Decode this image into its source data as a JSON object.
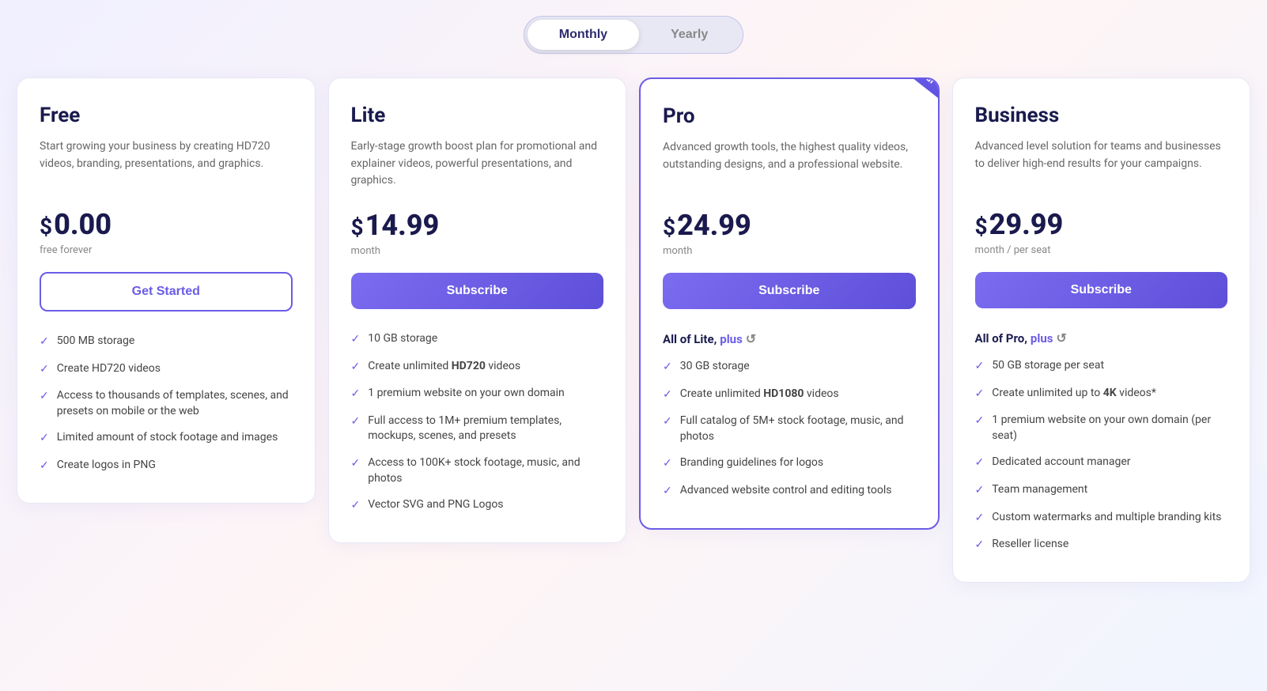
{
  "toggle": {
    "monthly_label": "Monthly",
    "yearly_label": "Yearly",
    "active": "monthly"
  },
  "plans": [
    {
      "id": "free",
      "name": "Free",
      "desc": "Start growing your business by creating HD720 videos, branding, presentations, and graphics.",
      "price_symbol": "$",
      "price_amount": "0.00",
      "price_period": "free forever",
      "button_label": "Get Started",
      "button_type": "outline",
      "features_header": null,
      "features": [
        {
          "text": "500 MB storage",
          "bold": null
        },
        {
          "text": "Create HD720 videos",
          "bold": null
        },
        {
          "text": "Access to thousands of templates, scenes, and presets on mobile or the web",
          "bold": null
        },
        {
          "text": "Limited amount of stock footage and images",
          "bold": null
        },
        {
          "text": "Create logos in PNG",
          "bold": null
        }
      ]
    },
    {
      "id": "lite",
      "name": "Lite",
      "desc": "Early-stage growth boost plan for promotional and explainer videos, powerful presentations, and graphics.",
      "price_symbol": "$",
      "price_amount": "14.99",
      "price_period": "month",
      "button_label": "Subscribe",
      "button_type": "filled",
      "features_header": null,
      "features": [
        {
          "text": "10 GB storage",
          "bold": null
        },
        {
          "text": "Create unlimited HD720 videos",
          "bold": "HD720"
        },
        {
          "text": "1 premium website on your own domain",
          "bold": null
        },
        {
          "text": "Full access to 1M+ premium templates, mockups, scenes, and presets",
          "bold": null
        },
        {
          "text": "Access to 100K+ stock footage, music, and photos",
          "bold": null
        },
        {
          "text": "Vector SVG and PNG Logos",
          "bold": null
        }
      ]
    },
    {
      "id": "pro",
      "name": "Pro",
      "desc": "Advanced growth tools, the highest quality videos, outstanding designs, and a professional website.",
      "price_symbol": "$",
      "price_amount": "24.99",
      "price_period": "month",
      "button_label": "Subscribe",
      "button_type": "filled",
      "ribbon": "Most Popular",
      "features_header": "All of Lite, plus",
      "features": [
        {
          "text": "30 GB storage",
          "bold": null
        },
        {
          "text": "Create unlimited HD1080 videos",
          "bold": "HD1080"
        },
        {
          "text": "Full catalog of 5M+ stock footage, music, and photos",
          "bold": null
        },
        {
          "text": "Branding guidelines for logos",
          "bold": null
        },
        {
          "text": "Advanced website control and editing tools",
          "bold": null
        }
      ]
    },
    {
      "id": "business",
      "name": "Business",
      "desc": "Advanced level solution for teams and businesses to deliver high-end results for your campaigns.",
      "price_symbol": "$",
      "price_amount": "29.99",
      "price_period": "month / per seat",
      "button_label": "Subscribe",
      "button_type": "filled",
      "features_header": "All of Pro, plus",
      "features": [
        {
          "text": "50 GB storage per seat",
          "bold": null
        },
        {
          "text": "Create unlimited up to 4K videos*",
          "bold": "4K"
        },
        {
          "text": "1 premium website on your own domain (per seat)",
          "bold": null,
          "extra": "(per seat)"
        },
        {
          "text": "Dedicated account manager",
          "bold": null
        },
        {
          "text": "Team management",
          "bold": null
        },
        {
          "text": "Custom watermarks and multiple branding kits",
          "bold": null
        },
        {
          "text": "Reseller license",
          "bold": null
        }
      ]
    }
  ]
}
